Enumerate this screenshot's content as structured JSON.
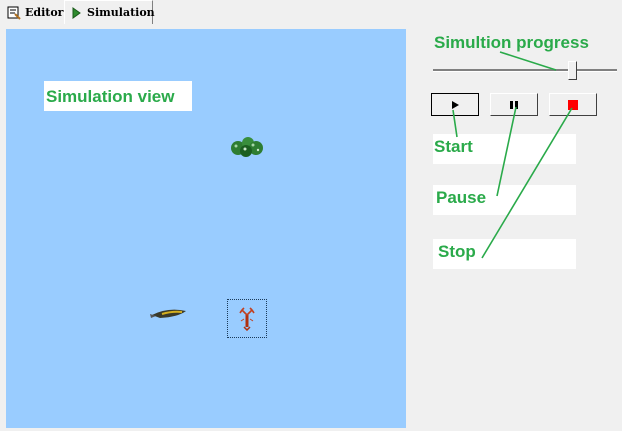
{
  "tabs": [
    {
      "label": "Editor",
      "icon": "editor-icon",
      "active": false
    },
    {
      "label": "Simulation",
      "icon": "play-icon",
      "active": true
    }
  ],
  "sim_view": {
    "annotation": "Simulation view",
    "background": "#99ccff",
    "objects": [
      "tree-cluster-icon",
      "fish-icon",
      "lobster-icon"
    ]
  },
  "controls": {
    "progress_label": "Simultion progress",
    "progress_value": 0.75,
    "buttons": [
      {
        "name": "start",
        "icon": "play-icon"
      },
      {
        "name": "pause",
        "icon": "pause-icon"
      },
      {
        "name": "stop",
        "icon": "stop-icon",
        "color": "#ff0000"
      }
    ],
    "annotations": {
      "start": "Start",
      "pause": "Pause",
      "stop": "Stop"
    }
  },
  "colors": {
    "annotation_green": "#2aaa4a",
    "stop_red": "#ff0000"
  }
}
